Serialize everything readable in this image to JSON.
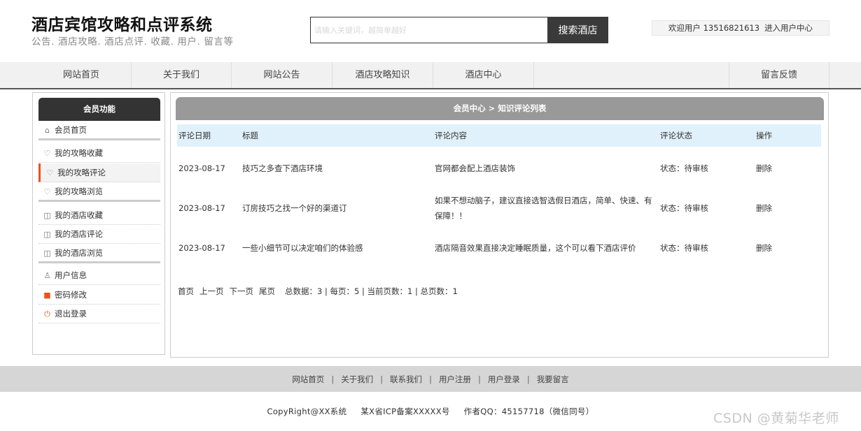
{
  "header": {
    "title": "酒店宾馆攻略和点评系统",
    "subtitle": "公告. 酒店攻略. 酒店点评. 收藏. 用户. 留言等"
  },
  "search": {
    "placeholder": "请输入关键词，越简单越好",
    "button_label": "搜索酒店"
  },
  "user": {
    "welcome_text": "欢迎用户 13516821613",
    "center_link": "进入用户中心"
  },
  "nav": {
    "items": [
      {
        "label": "网站首页"
      },
      {
        "label": "关于我们"
      },
      {
        "label": "网站公告"
      },
      {
        "label": "酒店攻略知识"
      },
      {
        "label": "酒店中心"
      },
      {
        "label": "留言反馈"
      }
    ]
  },
  "sidebar": {
    "title": "会员功能",
    "items": [
      {
        "label": "会员首页",
        "icon": "home-icon"
      },
      {
        "label": "我的攻略收藏",
        "icon": "badge-icon"
      },
      {
        "label": "我的攻略评论",
        "icon": "badge-icon",
        "active": true
      },
      {
        "label": "我的攻略浏览",
        "icon": "badge-icon"
      },
      {
        "label": "我的酒店收藏",
        "icon": "window-icon"
      },
      {
        "label": "我的酒店评论",
        "icon": "window-icon"
      },
      {
        "label": "我的酒店浏览",
        "icon": "window-icon"
      },
      {
        "label": "用户信息",
        "icon": "user-icon"
      },
      {
        "label": "密码修改",
        "icon": "lock-icon"
      },
      {
        "label": "退出登录",
        "icon": "power-icon"
      }
    ]
  },
  "main": {
    "title": "会员中心 > 知识评论列表",
    "columns": [
      "评论日期",
      "标题",
      "评论内容",
      "评论状态",
      "操作"
    ],
    "rows": [
      {
        "date": "2023-08-17",
        "title": "技巧之多查下酒店环境",
        "content": "官网都会配上酒店装饰",
        "status": "状态：待审核",
        "action": "删除"
      },
      {
        "date": "2023-08-17",
        "title": "订房技巧之找一个好的渠道订",
        "content": "如果不想动脑子，建议直接选智选假日酒店，简单、快速、有保障！！",
        "status": "状态：待审核",
        "action": "删除"
      },
      {
        "date": "2023-08-17",
        "title": "一些小细节可以决定咱们的体验感",
        "content": "酒店隔音效果直接决定睡眠质量，这个可以看下酒店评价",
        "status": "状态：待审核",
        "action": "删除"
      }
    ],
    "pager": {
      "first": "首页",
      "prev": "上一页",
      "next": "下一页",
      "last": "尾页",
      "info": "总数据：3 | 每页：5 | 当前页数：1 | 总页数：1"
    }
  },
  "footer": {
    "links": [
      "网站首页",
      "关于我们",
      "联系我们",
      "用户注册",
      "用户登录",
      "我要留言"
    ],
    "copyright": "CopyRight@XX系统",
    "icp": "某X省ICP备案XXXXX号",
    "author": "作者QQ：45157718（微信同号）"
  },
  "watermark": "CSDN @黄菊华老师",
  "colors": {
    "accent": "#e8541c",
    "dark": "#333333",
    "table_header_bg": "#e1f1fb",
    "main_header_bg": "#999999"
  }
}
